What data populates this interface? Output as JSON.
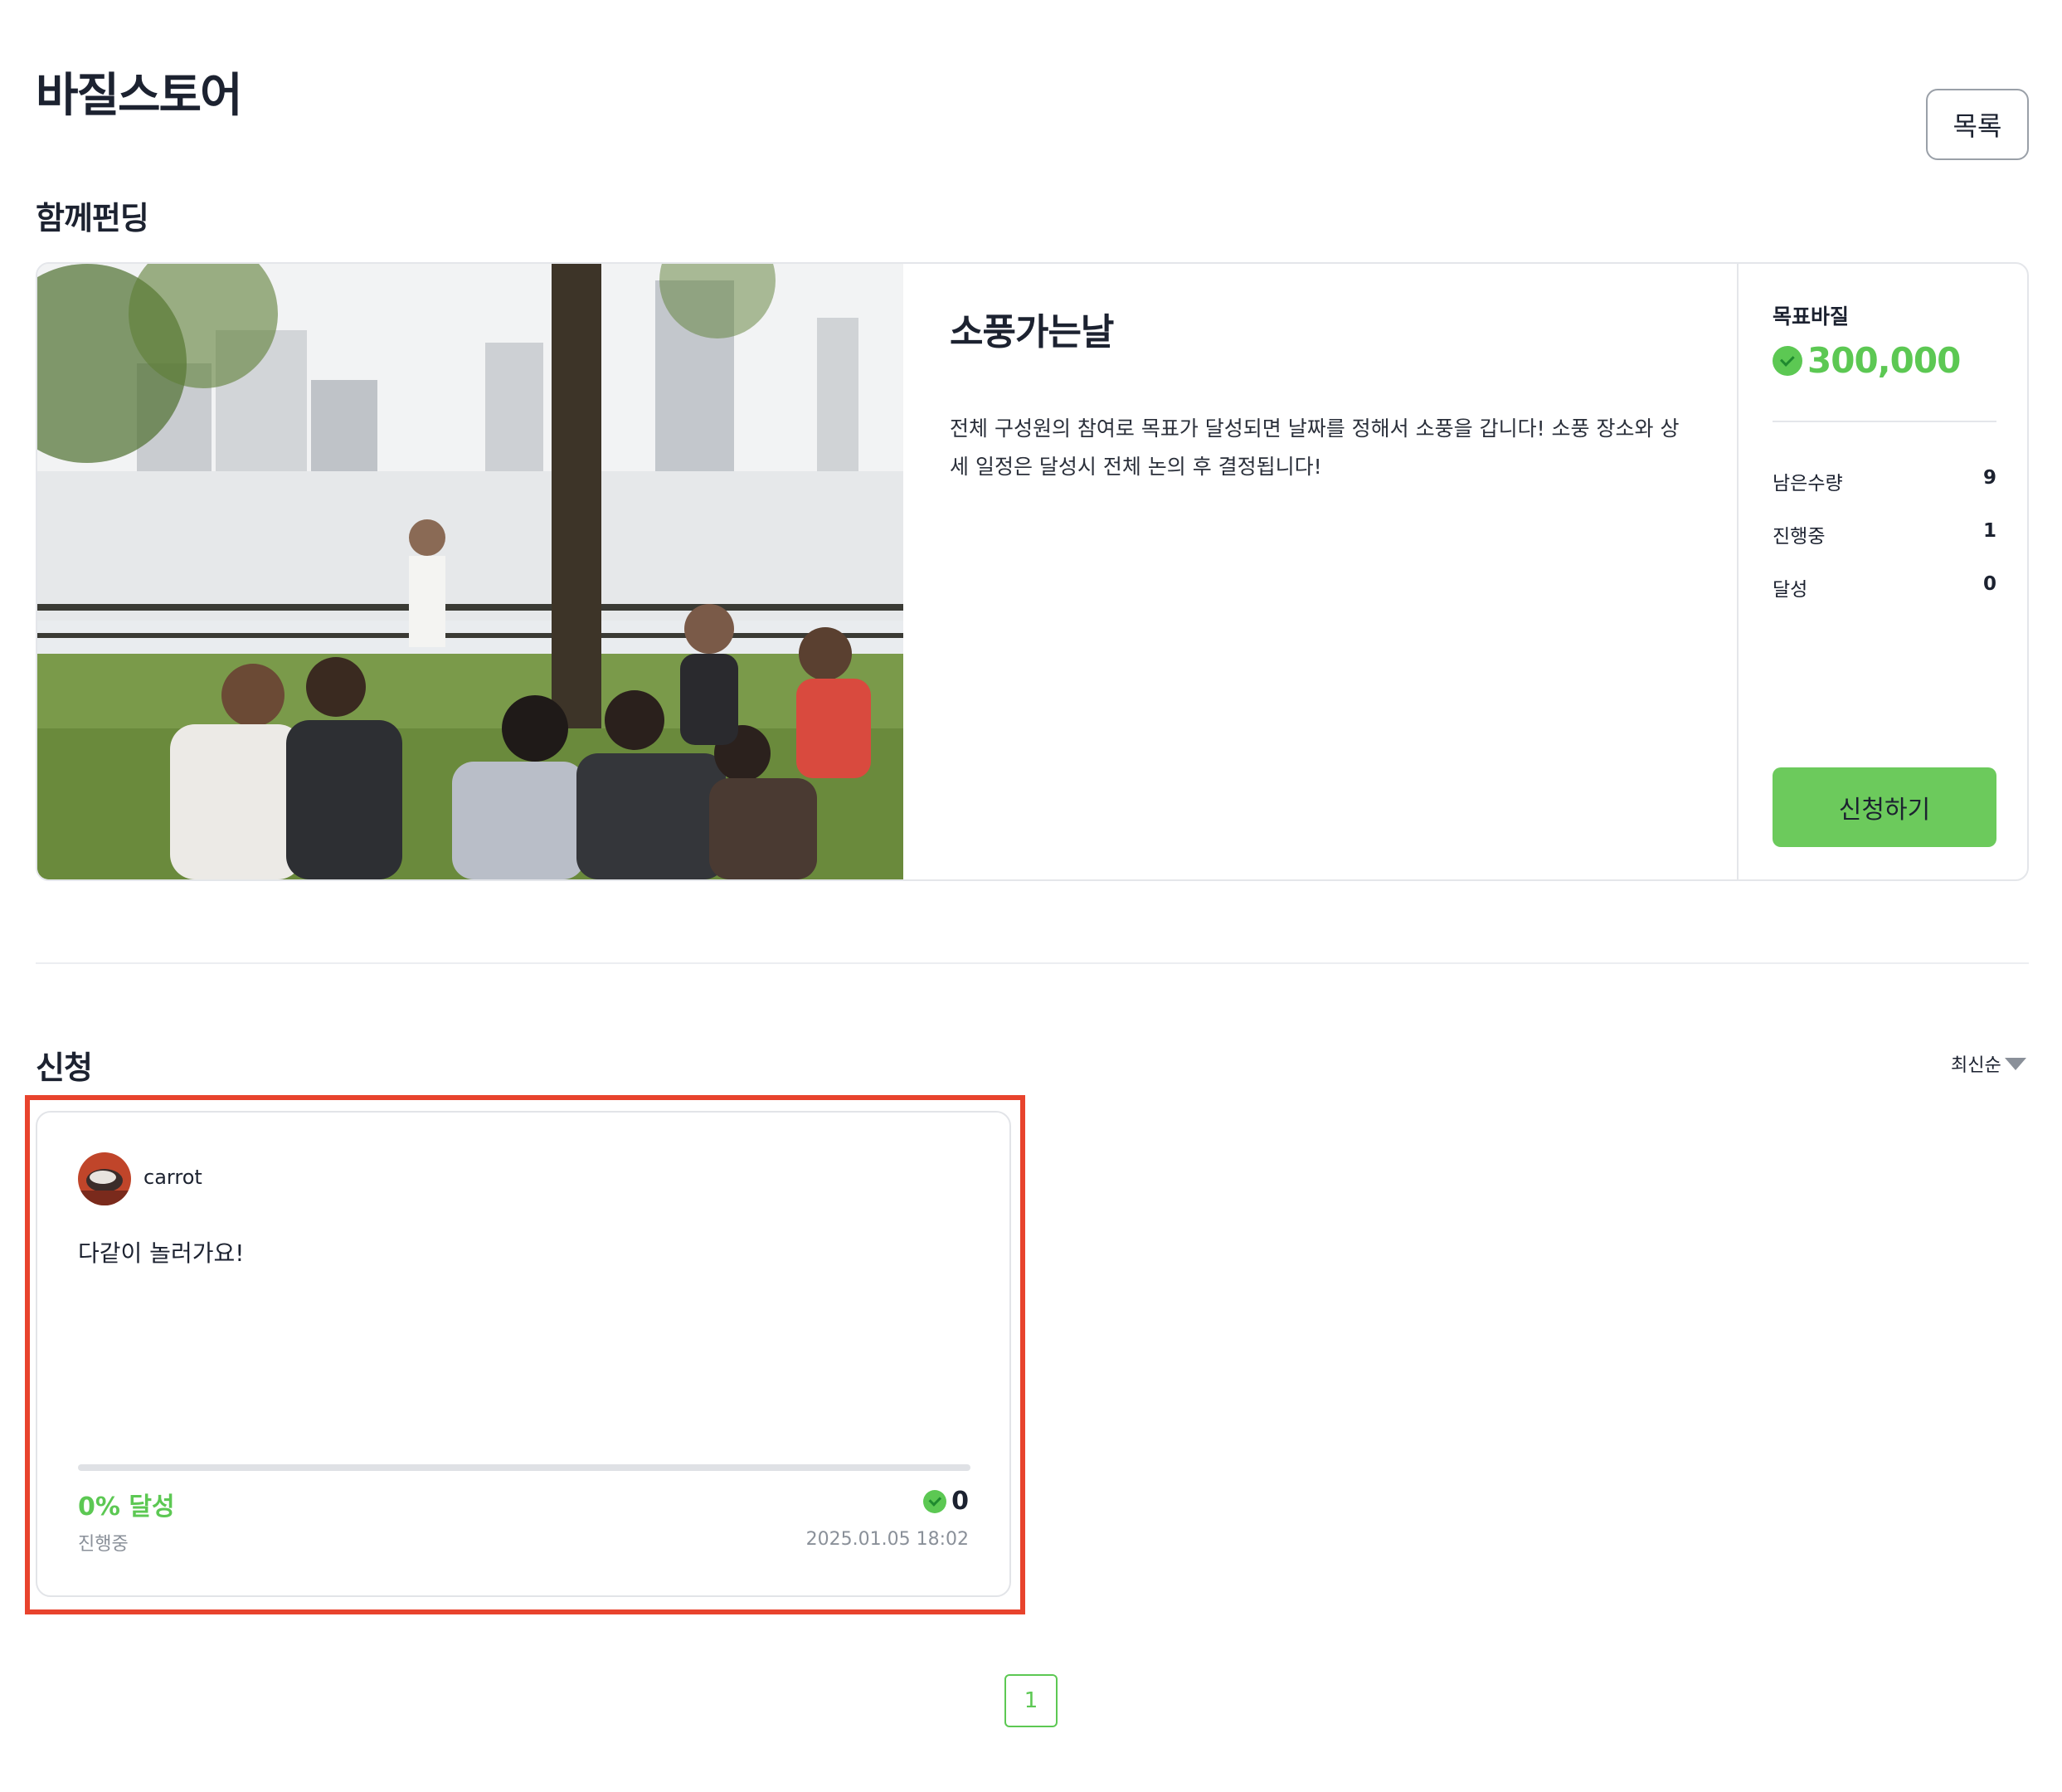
{
  "header": {
    "title": "바질스토어",
    "list_button": "목록"
  },
  "funding": {
    "section_title": "함께펀딩",
    "name": "소풍가는날",
    "description": "전체 구성원의 참여로 목표가 달성되면 날짜를 정해서 소풍을 갑니다! 소풍 장소와 상세 일정은 달성시 전체 논의 후 결정됩니다!",
    "goal_label": "목표바질",
    "goal_value": "300,000",
    "stats": [
      {
        "label": "남은수량",
        "value": "9"
      },
      {
        "label": "진행중",
        "value": "1"
      },
      {
        "label": "달성",
        "value": "0"
      }
    ],
    "apply_button": "신청하기"
  },
  "applications": {
    "section_title": "신청",
    "sort_label": "최신순",
    "items": [
      {
        "user": "carrot",
        "comment": "다같이 놀러가요!",
        "progress_percent": 0,
        "progress_text": "0% 달성",
        "amount": "0",
        "status": "진행중",
        "date": "2025.01.05 18:02"
      }
    ]
  },
  "pagination": {
    "pages": [
      "1"
    ],
    "current": "1"
  },
  "colors": {
    "accent": "#5cc853",
    "button": "#6cca5c",
    "highlight": "#e8432d"
  }
}
